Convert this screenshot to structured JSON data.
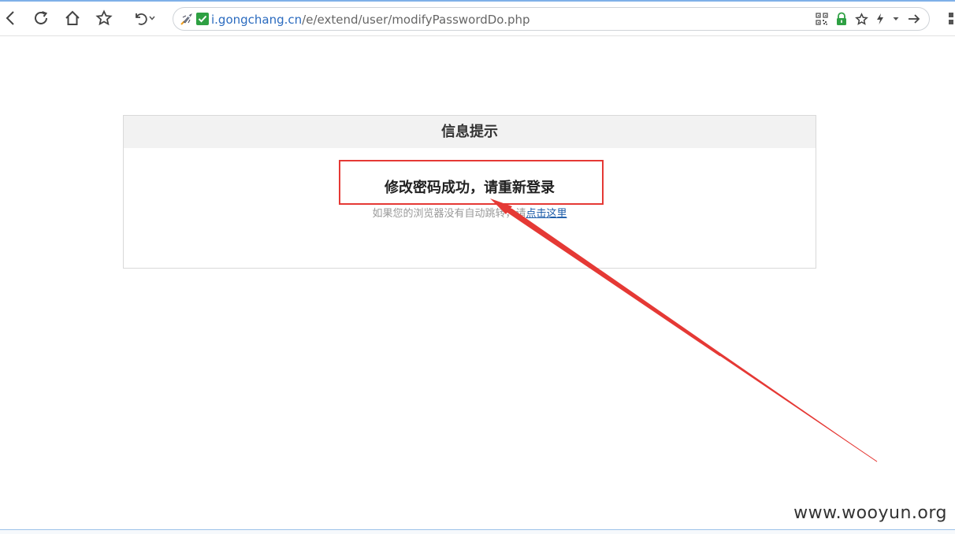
{
  "browser": {
    "url_host": "i.gongchang.cn",
    "url_path": "/e/extend/user/modifyPasswordDo.php"
  },
  "message_box": {
    "header": "信息提示",
    "title": "修改密码成功，请重新登录",
    "tip_prefix": "如果您的浏览器没有自动跳转，请",
    "tip_link": "点击这里"
  },
  "watermark": "www.wooyun.org",
  "colors": {
    "accent_link": "#1a5aa8",
    "annotation_red": "#e53935",
    "header_bg": "#f2f2f2"
  },
  "icons": {
    "toolbar": [
      "back-icon",
      "reload-icon",
      "home-icon",
      "bookmark-star-icon",
      "undo-icon",
      "dropdown-icon"
    ],
    "address_left": [
      "rocket-icon",
      "verified-check-icon"
    ],
    "address_right": [
      "qrcode-icon",
      "lock-icon",
      "favorite-star-icon",
      "lightning-icon",
      "dropdown-icon",
      "go-arrow-icon"
    ]
  }
}
